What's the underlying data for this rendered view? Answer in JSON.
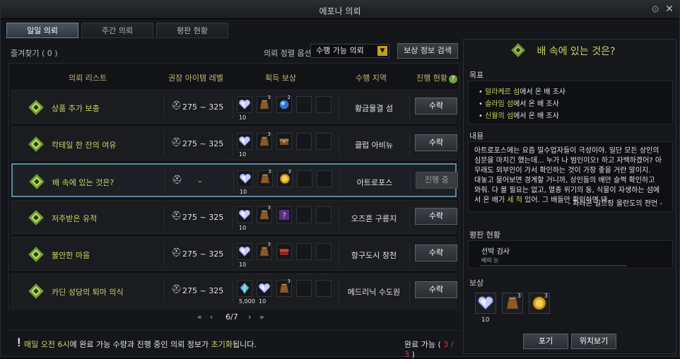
{
  "window": {
    "title": "에포나 의뢰"
  },
  "tabs": [
    {
      "label": "일일 의뢰",
      "active": true
    },
    {
      "label": "주간 의뢰",
      "active": false
    },
    {
      "label": "평판 현황",
      "active": false
    }
  ],
  "toolbar": {
    "favorites": "즐겨찾기 ( 0 )",
    "sort_label": "의뢰 정렬 옵션",
    "sort_value": "수행 가능 의뢰",
    "reward_search": "보상 정보 검색"
  },
  "list": {
    "headers": {
      "name": "의뢰 리스트",
      "level": "권장 아이템 레벨",
      "reward": "획득 보상",
      "region": "수행 지역",
      "status": "진행 현황",
      "help": "?"
    },
    "rows": [
      {
        "name": "상품 추가 보충",
        "level": "275 ~ 325",
        "region": "황금물결 섬",
        "button": "수락",
        "in_progress": false,
        "rewards": [
          {
            "icon": "silver-heart-icon",
            "qty": "10",
            "count": ""
          },
          {
            "icon": "pouch-icon",
            "qty": "",
            "count": "3"
          },
          {
            "icon": "blue-orb-icon",
            "qty": "",
            "count": "2"
          }
        ]
      },
      {
        "name": "칵테일 한 잔의 여유",
        "level": "275 ~ 325",
        "region": "클럽 아비뉴",
        "button": "수락",
        "in_progress": false,
        "rewards": [
          {
            "icon": "silver-heart-icon",
            "qty": "10",
            "count": ""
          },
          {
            "icon": "pouch-icon",
            "qty": "",
            "count": "3"
          },
          {
            "icon": "chest-icon",
            "qty": "",
            "count": ""
          }
        ]
      },
      {
        "name": "배 속에 있는 것은?",
        "level": "–",
        "region": "아트로포스",
        "button": "진행 중",
        "in_progress": true,
        "rewards": [
          {
            "icon": "silver-heart-icon",
            "qty": "10",
            "count": ""
          },
          {
            "icon": "pouch-icon",
            "qty": "",
            "count": "3"
          },
          {
            "icon": "gold-coin-icon",
            "qty": "",
            "count": "3"
          }
        ]
      },
      {
        "name": "저주받은 유적",
        "level": "275 ~ 325",
        "region": "오즈혼 구릉지",
        "button": "수락",
        "in_progress": false,
        "rewards": [
          {
            "icon": "silver-heart-icon",
            "qty": "10",
            "count": ""
          },
          {
            "icon": "pouch-icon",
            "qty": "",
            "count": "3"
          },
          {
            "icon": "mystery-box-icon",
            "qty": "",
            "count": ""
          }
        ]
      },
      {
        "name": "불안한 마음",
        "level": "275 ~ 325",
        "region": "항구도시 창천",
        "button": "수락",
        "in_progress": false,
        "rewards": [
          {
            "icon": "silver-heart-icon",
            "qty": "10",
            "count": ""
          },
          {
            "icon": "pouch-icon",
            "qty": "",
            "count": "3"
          },
          {
            "icon": "red-chest-icon",
            "qty": "",
            "count": ""
          }
        ]
      },
      {
        "name": "카딘 성당의 퇴마 의식",
        "level": "275 ~ 325",
        "region": "메드리닉 수도원",
        "button": "수락",
        "in_progress": false,
        "rewards": [
          {
            "icon": "crystal-icon",
            "qty": "5,000",
            "count": ""
          },
          {
            "icon": "silver-heart-icon",
            "qty": "10",
            "count": ""
          },
          {
            "icon": "pouch-icon",
            "qty": "",
            "count": "3"
          }
        ]
      }
    ]
  },
  "pager": {
    "first": "«",
    "prev": "‹",
    "page": "6/7",
    "next": "›",
    "last": "»"
  },
  "bottom": {
    "notice_pre": "매일 오전 6시",
    "notice_mid": "에 완료 가능 수량과 진행 중인 의뢰 정보가 ",
    "notice_hl": "초기화",
    "notice_post": "됩니다.",
    "complete_label": "완료 가능 (",
    "complete_value": "3 / 3",
    "complete_close": ")"
  },
  "detail": {
    "title": "배 속에 있는 것은?",
    "objective_label": "목표",
    "objectives": [
      {
        "loc": "알라케르 섬",
        "text": "에서 온 배 조사"
      },
      {
        "loc": "슬라임 섬",
        "text": "에서 온 배 조사"
      },
      {
        "loc": "신월의 섬",
        "text": "에서 온 배 조사"
      }
    ],
    "content_label": "내용",
    "content_lines": [
      "아트로포스에는 요즘 밀수업자들이 극성이야. 일단 모든 상인의",
      "심문을 마치긴 했는데... 누가 나 범인이오! 하고 자백하겠어? 아",
      "무래도 외부인이 가서 확인하는 것이 가장 좋을 거란 말이지.",
      "대놓고 물어보면 경계할 거니까, 상인들의 배만 슬쩍 확인하고",
      "와줘. 다 볼 필요는 없고, 멸종 위기의 동, 식물이 자생하는 섬에"
    ],
    "content_last_pre": "서 온 배가 ",
    "content_last_hl": "세 척",
    "content_last_post": " 있어. 그 배들만 확인하면 돼.",
    "content_sign": "- 파라곤 길드장 올란도의 전언 -",
    "rep_label": "평판 현황",
    "rep_name": "선박 검사",
    "rep_sub": "배의 눈",
    "reward_label": "보상",
    "rewards": [
      {
        "icon": "silver-heart-icon",
        "qty": "10",
        "count": ""
      },
      {
        "icon": "pouch-icon",
        "qty": "",
        "count": "3"
      },
      {
        "icon": "gold-coin-icon",
        "qty": "",
        "count": "3"
      }
    ],
    "btn_abandon": "포기",
    "btn_locate": "위치보기"
  },
  "colors": {
    "accent_green": "#c9d660",
    "tab_active": "#4a5561",
    "red": "#d43b3b",
    "select_gold": "#c5a21c"
  }
}
